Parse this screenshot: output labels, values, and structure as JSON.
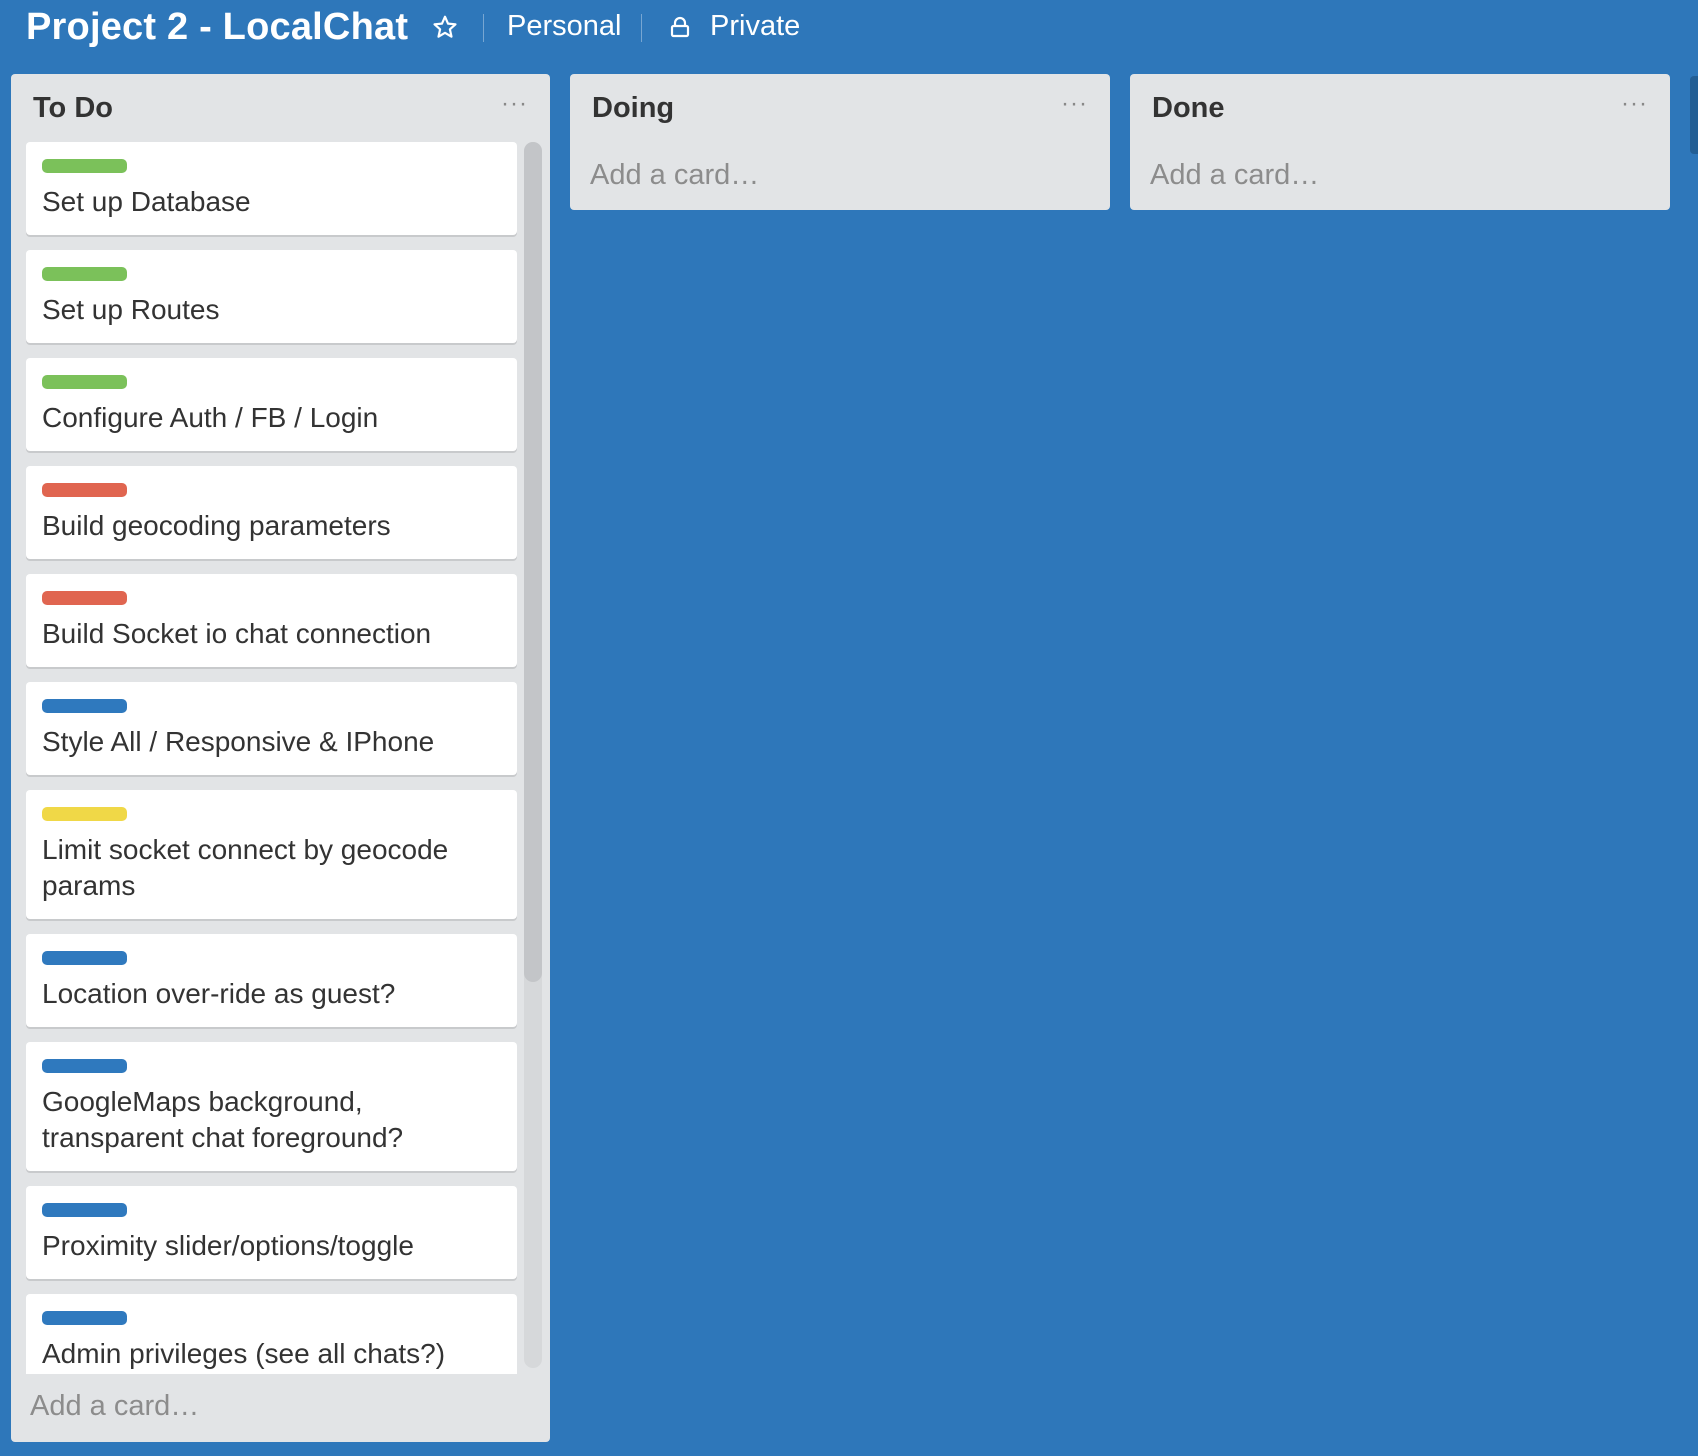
{
  "header": {
    "title": "Project 2 - LocalChat",
    "star_icon": "star-outline-icon",
    "team": "Personal",
    "visibility": "Private",
    "visibility_icon": "lock-icon"
  },
  "colors": {
    "board_background": "#2e77ba",
    "list_background": "#e2e4e6",
    "label_green": "#7bc15a",
    "label_red": "#e06550",
    "label_blue": "#2f79be",
    "label_yellow": "#f0d847"
  },
  "lists": [
    {
      "name": "To Do",
      "menu": "···",
      "add_card": "Add a card…",
      "cards": [
        {
          "label_color": "green",
          "title": "Set up Database"
        },
        {
          "label_color": "green",
          "title": "Set up Routes"
        },
        {
          "label_color": "green",
          "title": "Configure Auth / FB / Login"
        },
        {
          "label_color": "red",
          "title": "Build geocoding parameters"
        },
        {
          "label_color": "red",
          "title": "Build Socket io chat connection"
        },
        {
          "label_color": "blue",
          "title": "Style All / Responsive & IPhone"
        },
        {
          "label_color": "yellow",
          "title": "Limit socket connect by geocode params"
        },
        {
          "label_color": "blue",
          "title": "Location over-ride as guest?"
        },
        {
          "label_color": "blue",
          "title": "GoogleMaps background, transparent chat foreground?"
        },
        {
          "label_color": "blue",
          "title": "Proximity slider/options/toggle"
        },
        {
          "label_color": "blue",
          "title": "Admin privileges (see all chats?)"
        }
      ]
    },
    {
      "name": "Doing",
      "menu": "···",
      "add_card": "Add a card…",
      "cards": []
    },
    {
      "name": "Done",
      "menu": "···",
      "add_card": "Add a card…",
      "cards": []
    }
  ]
}
